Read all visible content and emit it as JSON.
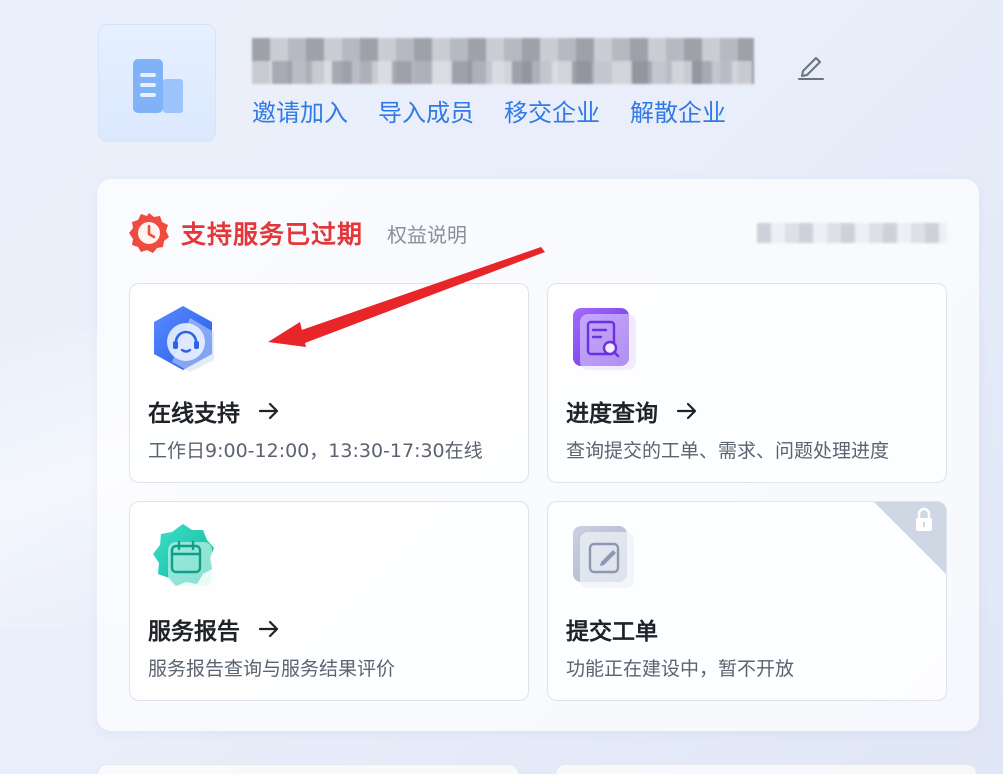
{
  "company": {
    "logo_icon": "building-icon",
    "edit_icon": "pencil-icon",
    "actions": [
      "邀请加入",
      "导入成员",
      "移交企业",
      "解散企业"
    ]
  },
  "service": {
    "status_icon": "clock-badge-icon",
    "status_text": "支持服务已过期",
    "rights_link": "权益说明",
    "status_color": "#e3383a",
    "cards": [
      {
        "title": "在线支持",
        "desc": "工作日9:00-12:00，13:30-17:30在线",
        "icon": "headset-icon",
        "has_arrow": true,
        "locked": false
      },
      {
        "title": "进度查询",
        "desc": "查询提交的工单、需求、问题处理进度",
        "icon": "document-search-icon",
        "has_arrow": true,
        "locked": false
      },
      {
        "title": "服务报告",
        "desc": "服务报告查询与服务结果评价",
        "icon": "calendar-icon",
        "has_arrow": true,
        "locked": false
      },
      {
        "title": "提交工单",
        "desc": "功能正在建设中，暂不开放",
        "icon": "edit-form-icon",
        "has_arrow": false,
        "locked": true,
        "corner_icon": "lock-icon"
      }
    ]
  },
  "colors": {
    "link_blue": "#2f7ae5",
    "expired_red": "#e3383a",
    "annotation_red": "#e8262a"
  }
}
